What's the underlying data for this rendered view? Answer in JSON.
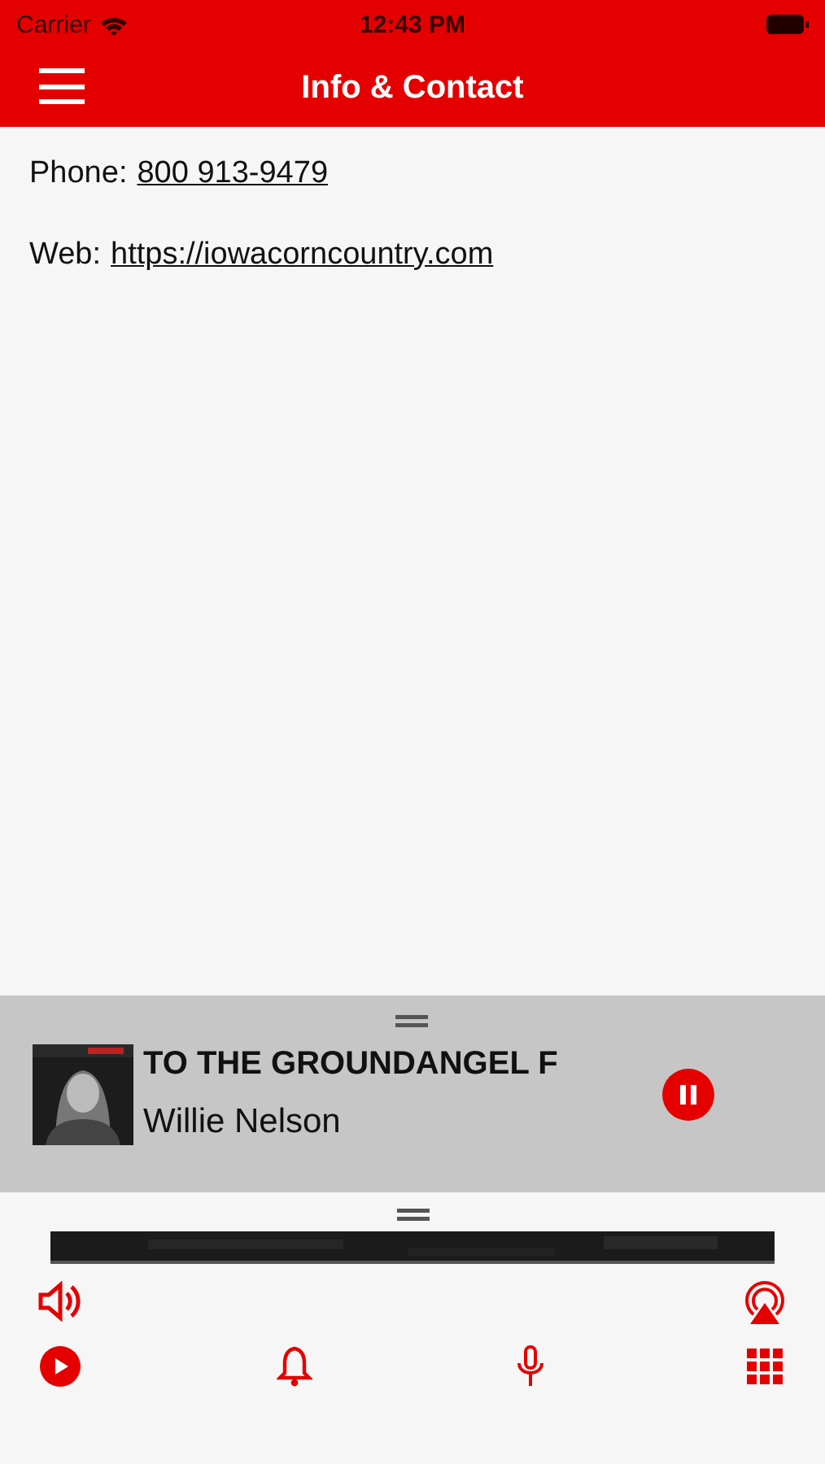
{
  "status_bar": {
    "carrier": "Carrier",
    "time": "12:43 PM"
  },
  "nav_bar": {
    "title": "Info & Contact"
  },
  "contact": [
    {
      "label": "Phone:",
      "value": "800 913-9479"
    },
    {
      "label": "Web:",
      "value": "https://iowacorncountry.com"
    }
  ],
  "now_playing": {
    "title": "TO THE GROUNDANGEL F",
    "artist": "Willie Nelson",
    "playing": true
  },
  "tab_bar": [
    {
      "kind": "play"
    },
    {
      "kind": "bell"
    },
    {
      "kind": "mic"
    },
    {
      "kind": "grid"
    }
  ]
}
